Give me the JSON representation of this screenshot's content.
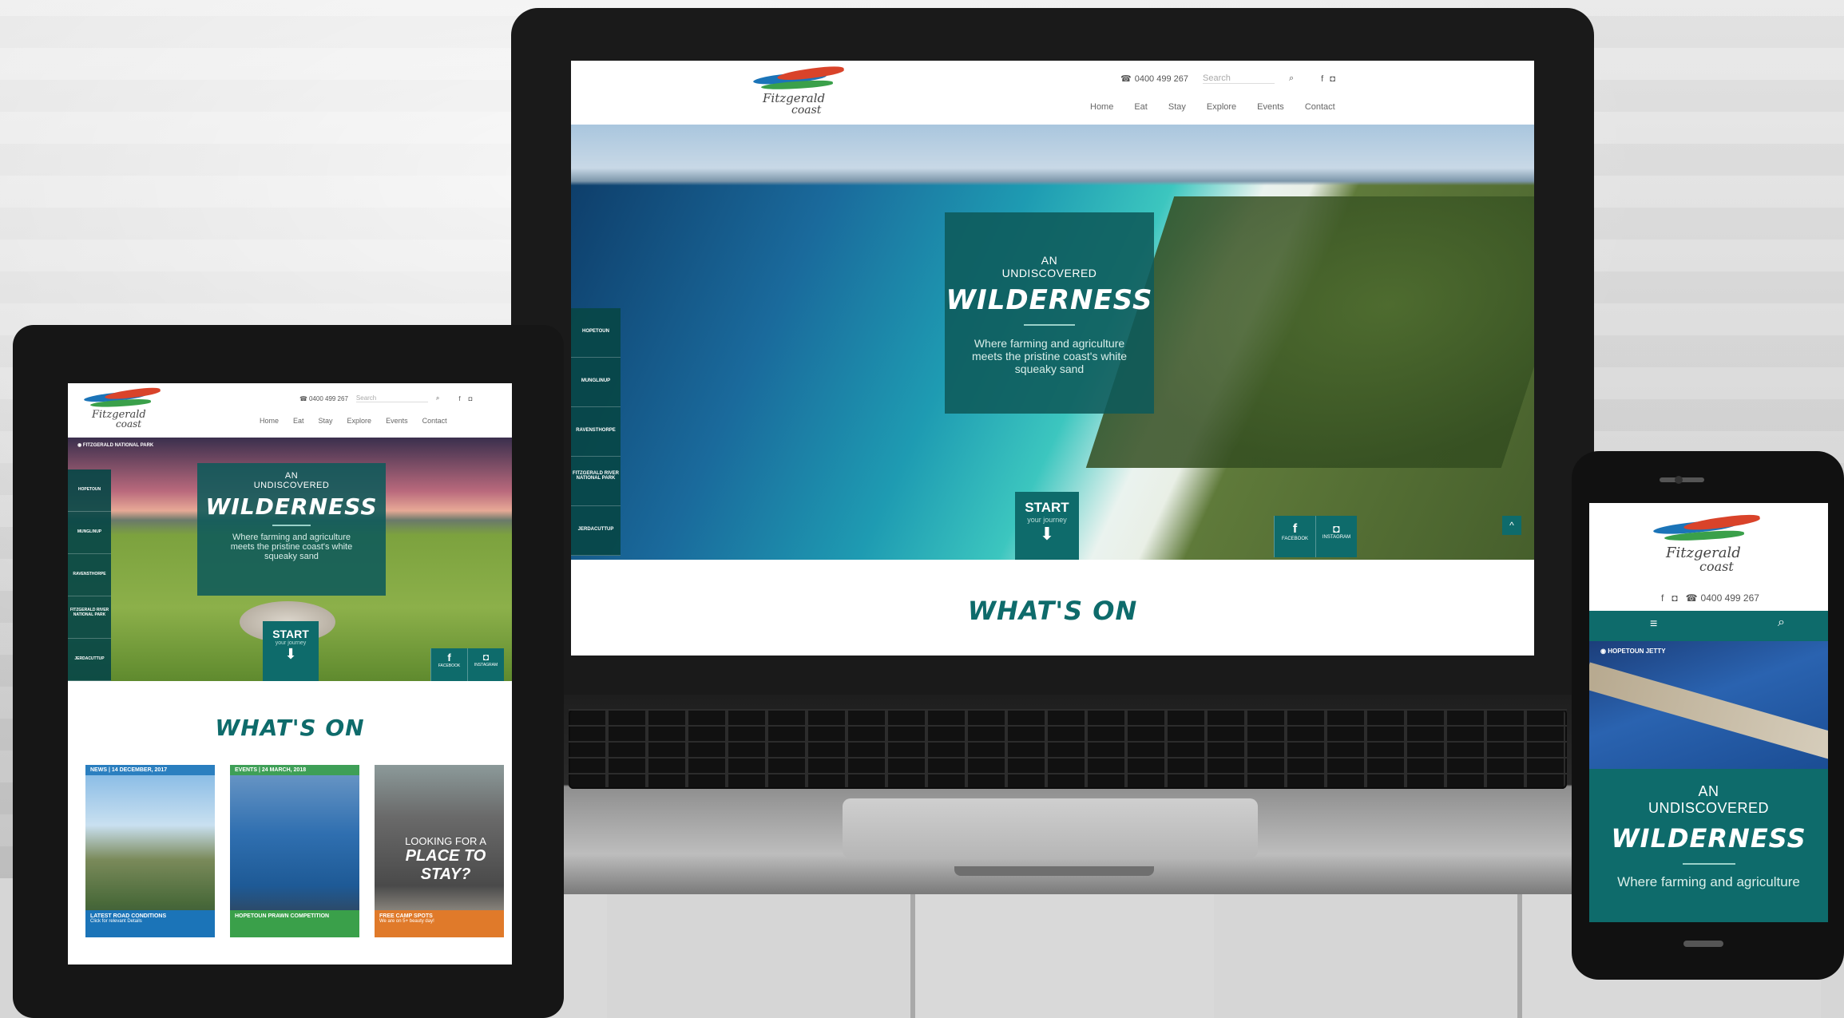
{
  "brand": {
    "logo_line1": "Fitzgerald",
    "logo_line2": "coast",
    "colors": {
      "teal": "#0e6b6b",
      "green": "#3aa04a",
      "orange": "#e07a2a",
      "blue": "#1b74b8",
      "red": "#d9432a"
    }
  },
  "header": {
    "phone": "0400 499 267",
    "search_placeholder": "Search",
    "nav": [
      "Home",
      "Eat",
      "Stay",
      "Explore",
      "Events",
      "Contact"
    ]
  },
  "hero": {
    "an": "AN",
    "undiscovered": "UNDISCOVERED",
    "title": "WILDERNESS",
    "subtitle_line1": "Where farming and agriculture",
    "subtitle_line2": "meets the pristine coast's white",
    "subtitle_line3": "squeaky sand",
    "start_label": "START",
    "start_sub": "your journey",
    "location_tablet": "FITZGERALD NATIONAL PARK",
    "side_tabs": [
      "HOPETOUN",
      "MUNGLINUP",
      "RAVENSTHORPE",
      "FITZGERALD RIVER NATIONAL PARK",
      "JERDACUTTUP"
    ],
    "social": [
      {
        "icon": "f",
        "label": "FACEBOOK"
      },
      {
        "icon": "◘",
        "label": "INSTAGRAM"
      }
    ]
  },
  "whats_on": "WHAT'S ON",
  "tablet_cards": [
    {
      "tag": "NEWS | 14 DECEMBER, 2017",
      "foot": "LATEST ROAD CONDITIONS",
      "sub": "Click for relevant Details",
      "color": "#1b74b8"
    },
    {
      "tag": "EVENTS | 24 MARCH, 2018",
      "foot": "HOPETOUN PRAWN COMPETITION",
      "sub": "",
      "color": "#3aa04a"
    },
    {
      "tag": "",
      "foot": "FREE CAMP SPOTS",
      "sub": "We are on 5+ beauty day!",
      "color": "#e07a2a",
      "overlay1": "LOOKING FOR A",
      "overlay2": "PLACE TO",
      "overlay3": "STAY?"
    }
  ],
  "phone": {
    "menu_icon": "≡",
    "search_icon": "⌕",
    "location": "HOPETOUN JETTY",
    "subtitle_line1": "Where farming and agriculture"
  }
}
